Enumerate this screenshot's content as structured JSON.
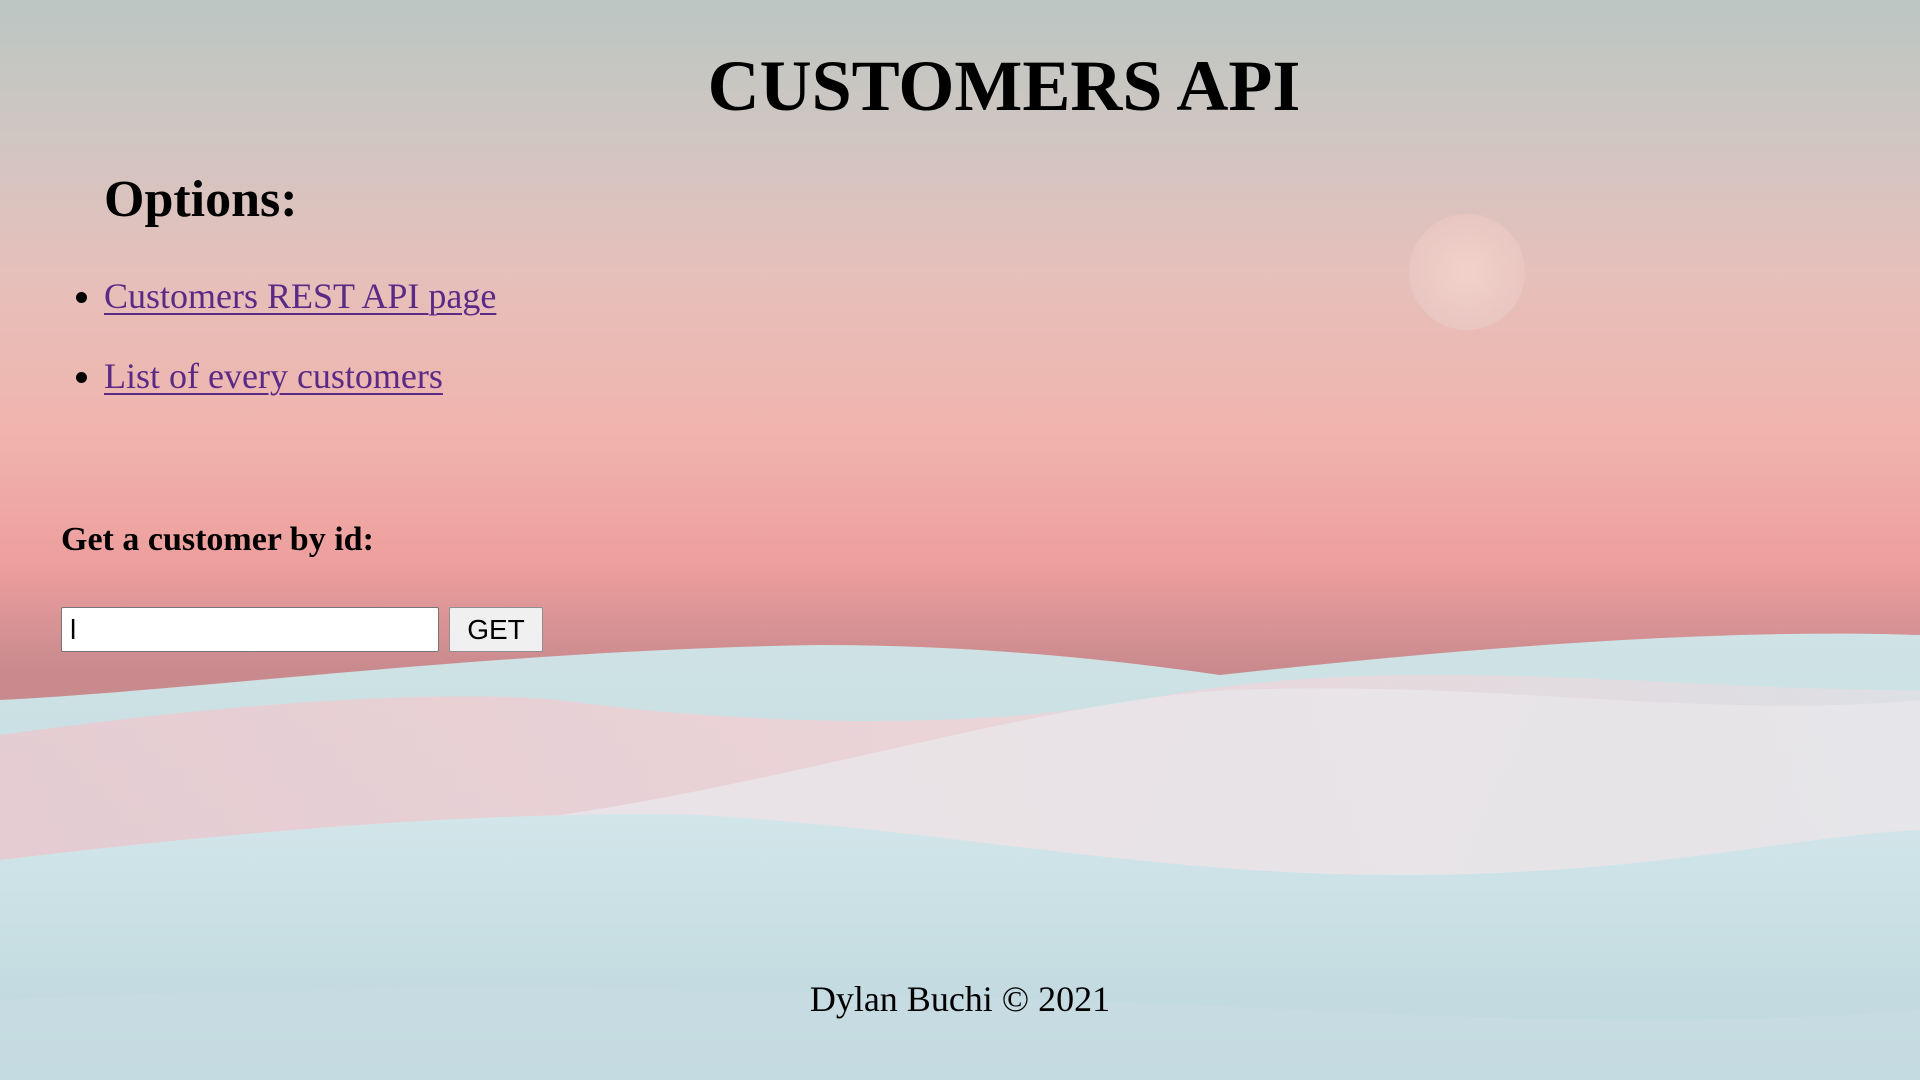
{
  "header": {
    "title": "CUSTOMERS API"
  },
  "options": {
    "heading": "Options:",
    "links": [
      {
        "label": "Customers REST API page"
      },
      {
        "label": "List of every customers"
      }
    ]
  },
  "lookup": {
    "label": "Get a customer by id:",
    "input_value": "l",
    "button_label": "GET"
  },
  "footer": {
    "text": "Dylan Buchi © 2021"
  },
  "colors": {
    "link_visited": "#5b2a86",
    "sky_top": "#c3c7c2",
    "sky_pink": "#f0b3ad",
    "dune": "#c6dde0"
  }
}
